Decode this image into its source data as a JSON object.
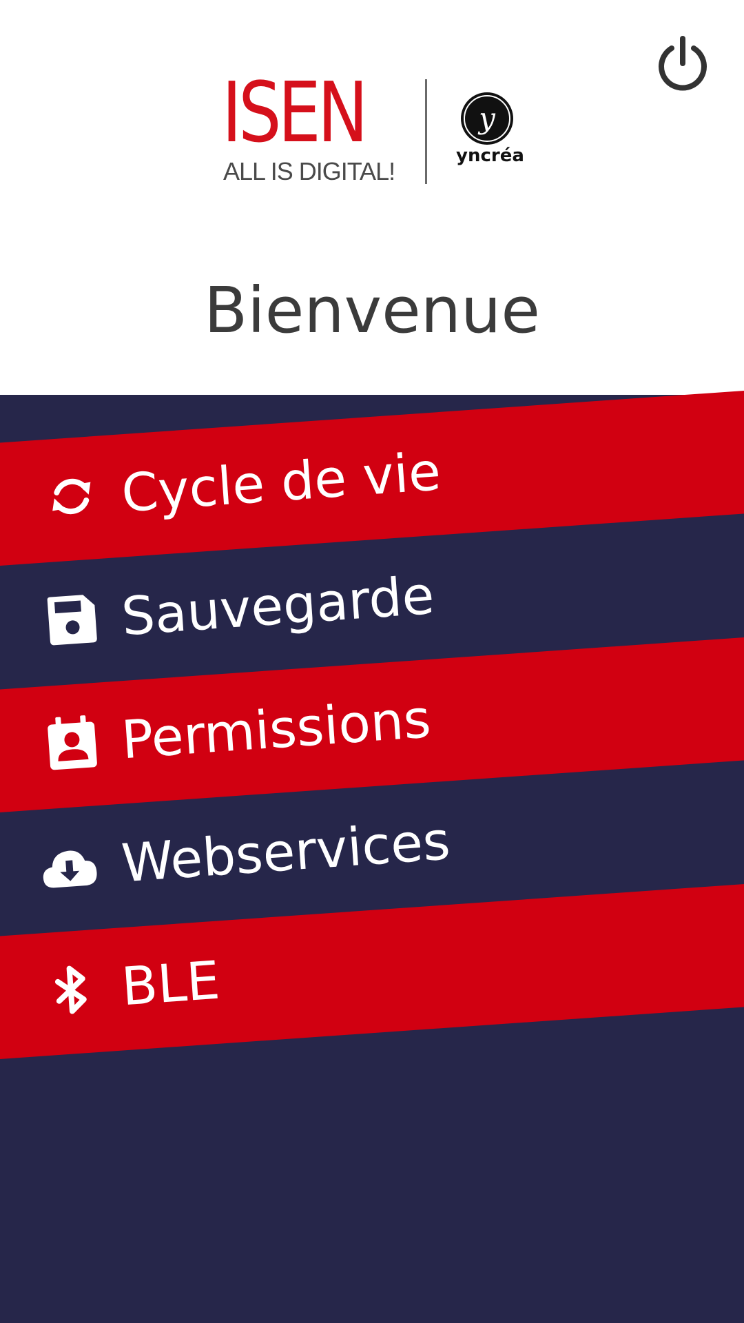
{
  "header": {
    "power_icon": "power-icon",
    "logo": {
      "brand": "ISEN",
      "tagline": "ALL IS DIGITAL!",
      "partner": "yncréa",
      "partner_mark": "y",
      "brand_color": "#d5101b"
    },
    "welcome": "Bienvenue"
  },
  "menu": {
    "background_color": "#26264a",
    "accent_color": "#d10011",
    "items": [
      {
        "label": "Cycle de vie",
        "icon": "refresh-icon",
        "highlighted": true
      },
      {
        "label": "Sauvegarde",
        "icon": "floppy-disk-icon",
        "highlighted": false
      },
      {
        "label": "Permissions",
        "icon": "contact-badge-icon",
        "highlighted": true
      },
      {
        "label": "Webservices",
        "icon": "cloud-download-icon",
        "highlighted": false
      },
      {
        "label": "BLE",
        "icon": "bluetooth-icon",
        "highlighted": true
      }
    ]
  }
}
